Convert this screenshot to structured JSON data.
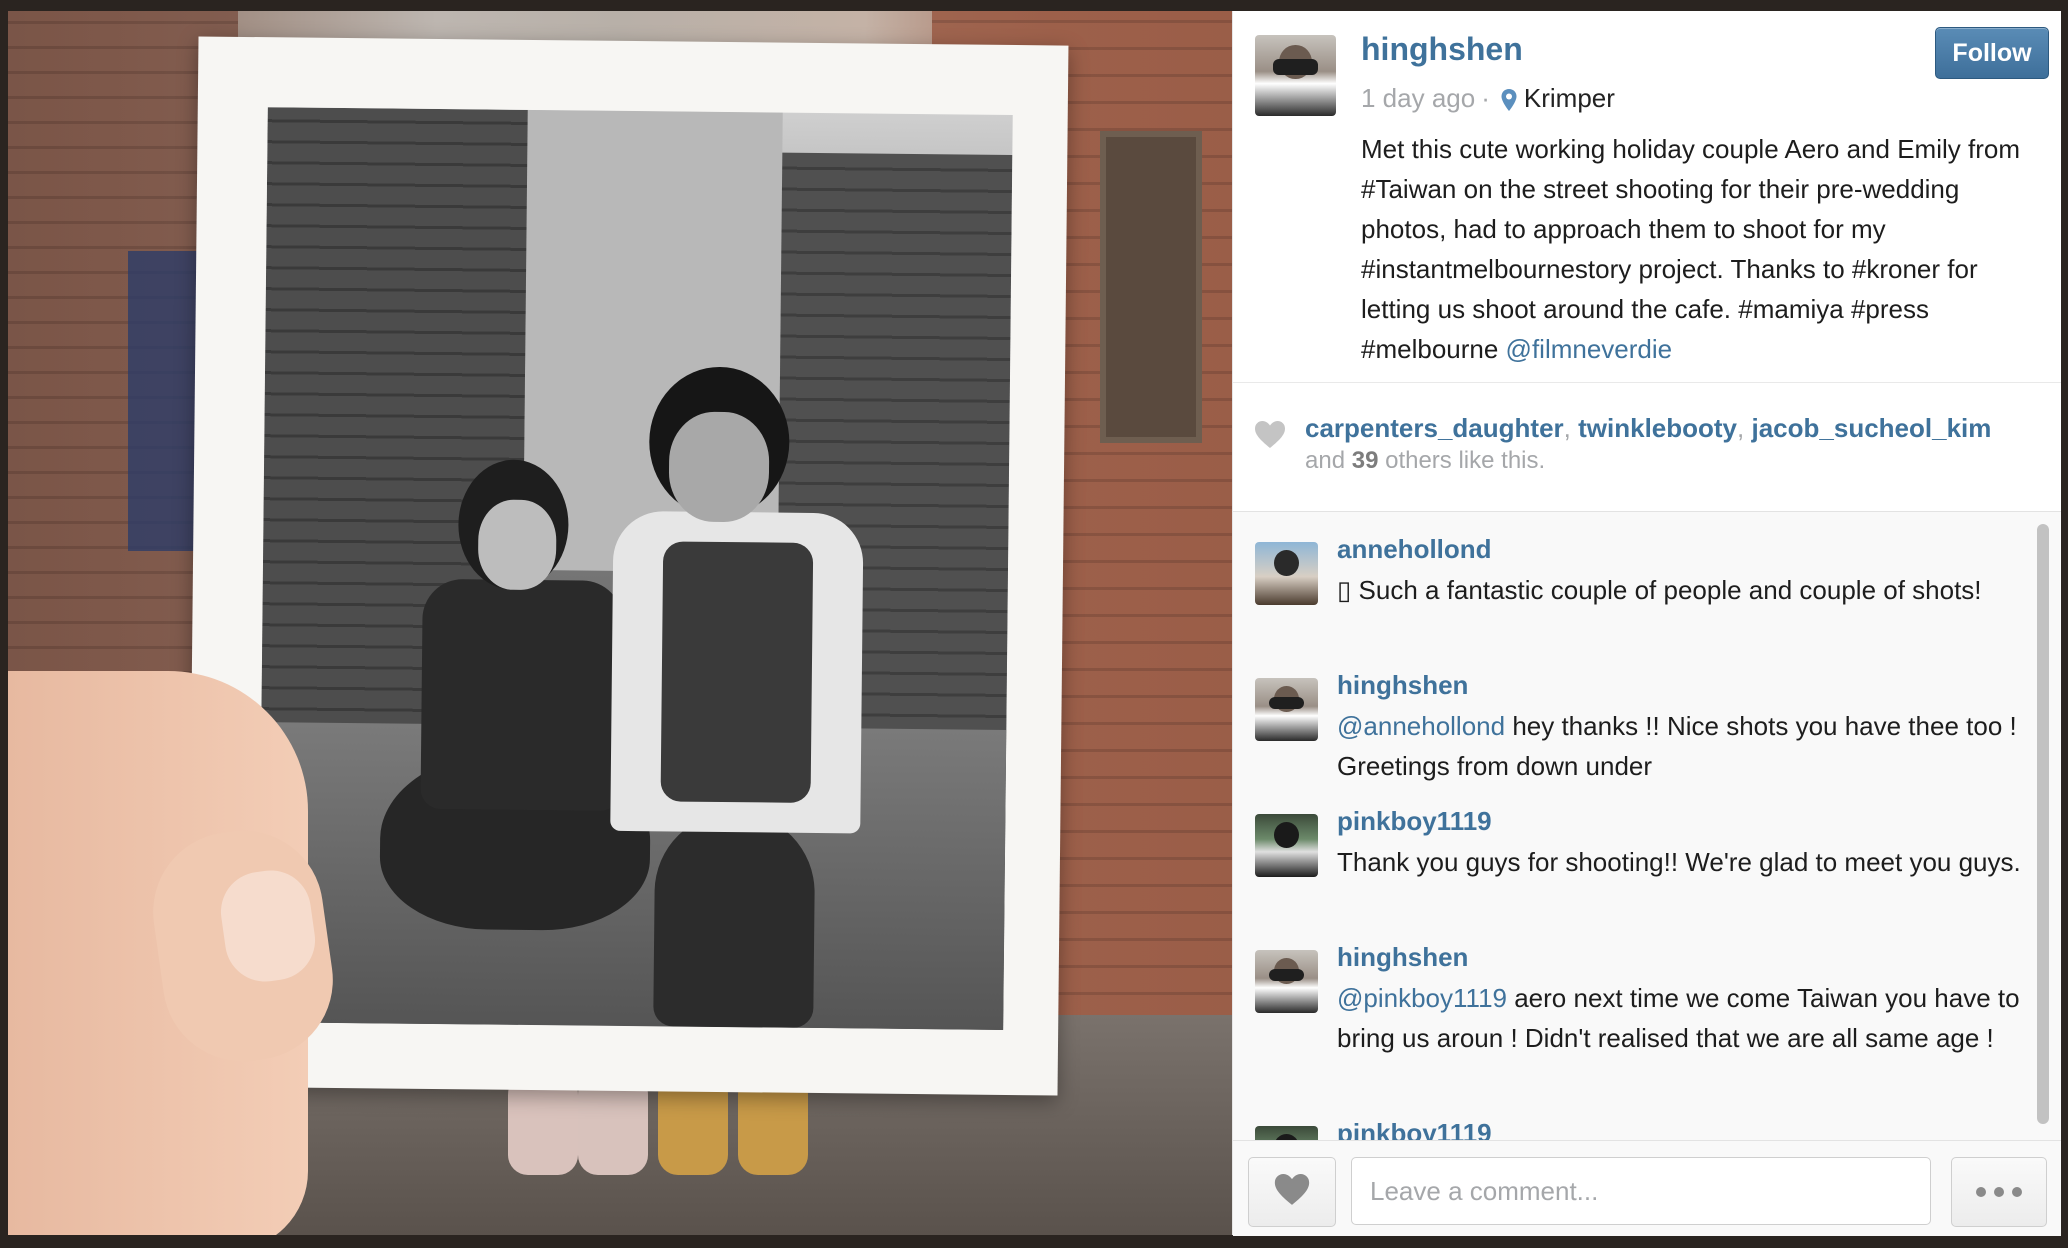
{
  "post": {
    "username": "hinghshen",
    "follow_label": "Follow",
    "time_ago": "1 day ago",
    "separator": "·",
    "location": "Krimper",
    "caption_text": "Met this cute working holiday couple Aero and Emily from #Taiwan on the street shooting for their pre-wedding photos, had to approach them to shoot for my #instantmelbournestory project. Thanks to #kroner for letting us shoot around the cafe. #mamiya #press #melbourne ",
    "caption_mention": "@filmneverdie"
  },
  "likes": {
    "users": [
      "carpenters_daughter",
      "twinklebooty",
      "jacob_sucheol_kim"
    ],
    "comma": ",",
    "prefix": "and",
    "count": "39",
    "suffix": "others like this."
  },
  "comments": [
    {
      "user": "annehollond",
      "mention": "",
      "text": " Such a fantastic couple of people and couple of shots!"
    },
    {
      "user": "hinghshen",
      "mention": "@annehollond",
      "text": " hey thanks !! Nice shots you have thee too ! Greetings from down under"
    },
    {
      "user": "pinkboy1119",
      "mention": "",
      "text": "Thank you guys for shooting!! We're glad to meet you guys."
    },
    {
      "user": "hinghshen",
      "mention": "@pinkboy1119",
      "text": " aero next time we come Taiwan you have to bring us aroun ! Didn't realised that we are all same age !"
    },
    {
      "user": "pinkboy1119",
      "mention": "",
      "text": ""
    }
  ],
  "footer": {
    "comment_placeholder": "Leave a comment..."
  },
  "icons": {
    "like": "heart-icon",
    "location": "pin-icon",
    "more": "more-icon"
  },
  "colors": {
    "link": "#3f729b",
    "follow_button": "#4a7ea9",
    "muted": "#a5a7aa"
  }
}
